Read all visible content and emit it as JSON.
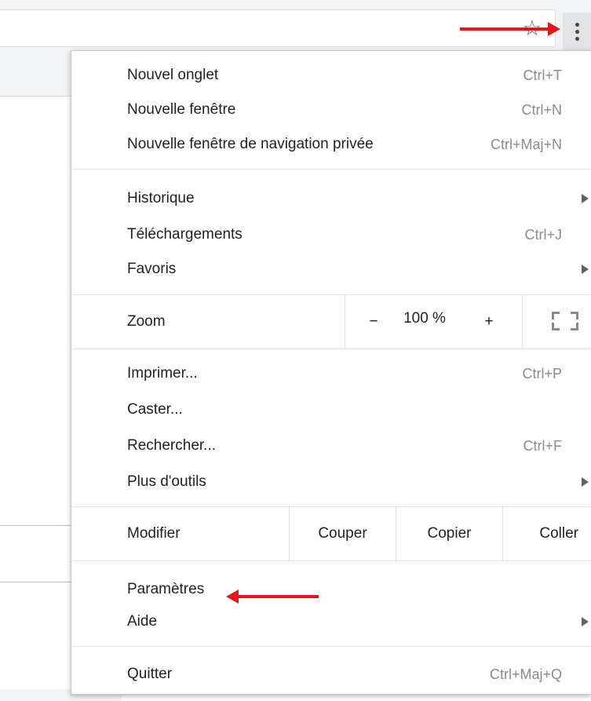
{
  "toolbar": {
    "star_glyph": "☆",
    "star_icon": "star-icon",
    "menu_icon": "vertical-dots-icon"
  },
  "menu": {
    "new_tab": {
      "label": "Nouvel onglet",
      "shortcut": "Ctrl+T"
    },
    "new_window": {
      "label": "Nouvelle fenêtre",
      "shortcut": "Ctrl+N"
    },
    "new_incognito": {
      "label": "Nouvelle fenêtre de navigation privée",
      "shortcut": "Ctrl+Maj+N"
    },
    "history": {
      "label": "Historique",
      "has_submenu": true
    },
    "downloads": {
      "label": "Téléchargements",
      "shortcut": "Ctrl+J"
    },
    "bookmarks": {
      "label": "Favoris",
      "has_submenu": true
    },
    "zoom": {
      "label": "Zoom",
      "minus": "−",
      "value": "100 %",
      "plus": "+",
      "fullscreen_icon": "fullscreen-icon"
    },
    "print": {
      "label": "Imprimer...",
      "shortcut": "Ctrl+P"
    },
    "cast": {
      "label": "Caster..."
    },
    "find": {
      "label": "Rechercher...",
      "shortcut": "Ctrl+F"
    },
    "more_tools": {
      "label": "Plus d'outils",
      "has_submenu": true
    },
    "edit": {
      "label": "Modifier",
      "cut": "Couper",
      "copy": "Copier",
      "paste": "Coller"
    },
    "settings": {
      "label": "Paramètres"
    },
    "help": {
      "label": "Aide",
      "has_submenu": true
    },
    "quit": {
      "label": "Quitter",
      "shortcut": "Ctrl+Maj+Q"
    }
  },
  "annotations": {
    "arrow_color": "#e3161b"
  }
}
